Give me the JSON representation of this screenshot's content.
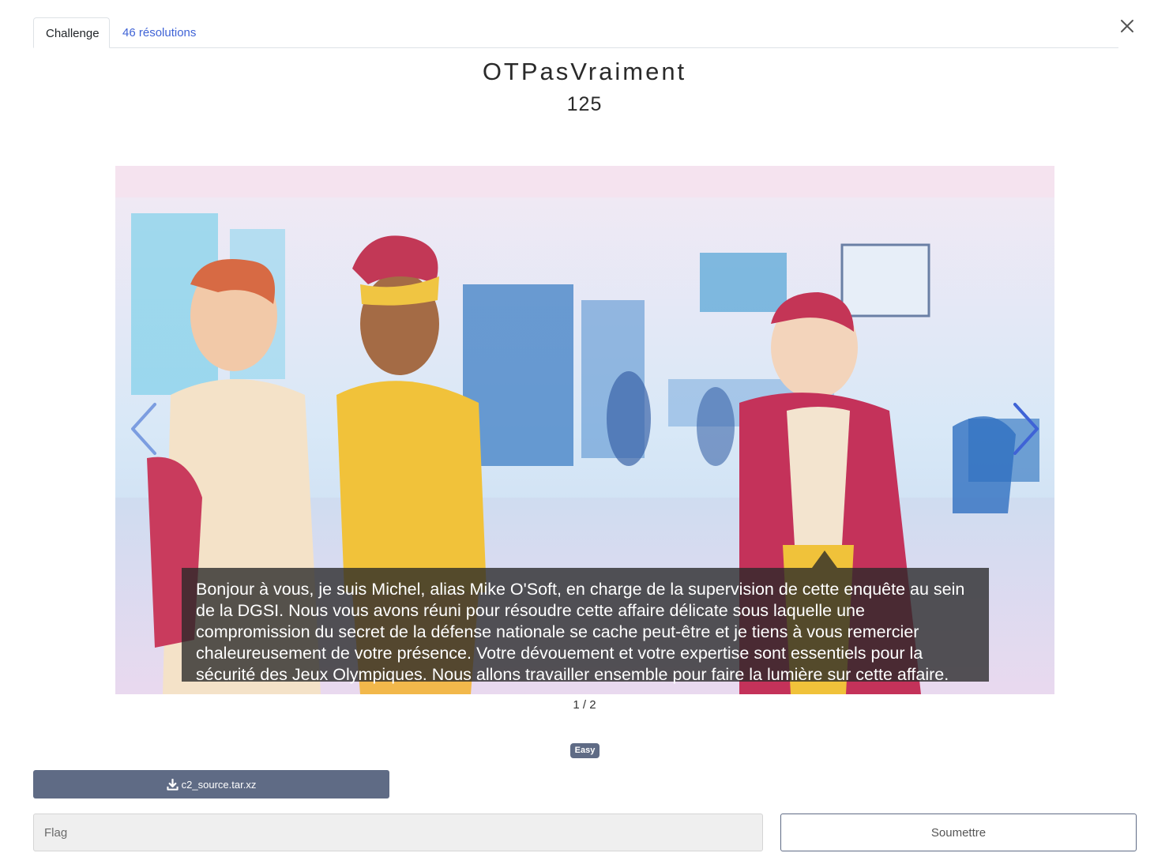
{
  "tabs": {
    "challenge_label": "Challenge",
    "solves_label": "46 résolutions"
  },
  "challenge": {
    "name": "OTPasVraiment",
    "points": "125",
    "difficulty": "Easy"
  },
  "carousel": {
    "caption": "Bonjour à vous, je suis Michel, alias Mike O'Soft, en charge de la supervision de cette enquête au sein de la DGSI. Nous vous avons réuni pour résoudre cette affaire délicate sous laquelle une compromission du secret de la défense nationale se cache peut-être et je tiens à vous remercier chaleureusement de votre présence. Votre dévouement et votre expertise sont essentiels pour la sécurité des Jeux Olympiques. Nous allons travailler ensemble pour faire la lumière sur cette affaire.",
    "counter": "1 / 2"
  },
  "files": {
    "download_label": "c2_source.tar.xz"
  },
  "form": {
    "flag_placeholder": "Flag",
    "submit_label": "Soumettre"
  },
  "icons": {
    "close": "close-icon",
    "prev": "chevron-left-icon",
    "next": "chevron-right-icon",
    "download": "download-icon"
  },
  "colors": {
    "accent": "#3f63d6",
    "badge": "#5f6b85",
    "button": "#5f6b85"
  }
}
